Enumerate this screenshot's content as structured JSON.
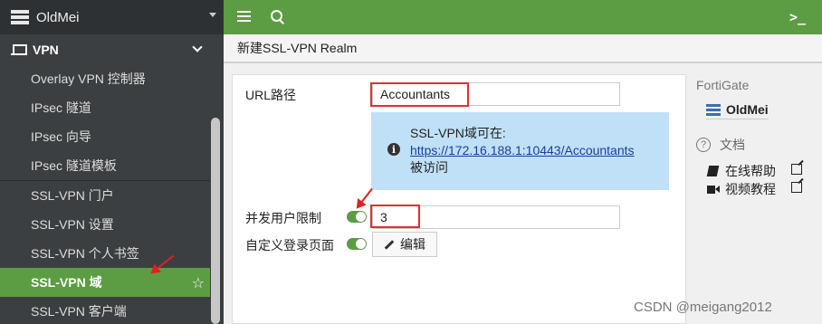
{
  "sidebar": {
    "device_name": "OldMei",
    "section_label": "VPN",
    "items": [
      {
        "label": "Overlay VPN 控制器"
      },
      {
        "label": "IPsec 隧道"
      },
      {
        "label": "IPsec 向导"
      },
      {
        "label": "IPsec 隧道模板"
      },
      {
        "label": "SSL-VPN 门户"
      },
      {
        "label": "SSL-VPN 设置"
      },
      {
        "label": "SSL-VPN 个人书签"
      },
      {
        "label": "SSL-VPN 域",
        "active": true
      },
      {
        "label": "SSL-VPN 客户端"
      }
    ]
  },
  "page": {
    "title": "新建SSL-VPN Realm"
  },
  "form": {
    "url_label": "URL路径",
    "url_value": "Accountants",
    "info_line1": "SSL-VPN域可在:",
    "info_link": "https://172.16.188.1:10443/Accountants",
    "info_line3": "被访问",
    "concurrent_label": "并发用户限制",
    "concurrent_value": "3",
    "custom_login_label": "自定义登录页面",
    "edit_label": "编辑"
  },
  "right_panel": {
    "title": "FortiGate",
    "device": "OldMei",
    "docs_label": "文档",
    "online_help": "在线帮助",
    "video_tutorial": "视频教程"
  },
  "watermark": "CSDN @meigang2012",
  "colors": {
    "accent_green": "#5c9c42",
    "sidebar_bg": "#3c3f41",
    "highlight_red": "#e03030",
    "info_blue": "#bfe0f7"
  }
}
